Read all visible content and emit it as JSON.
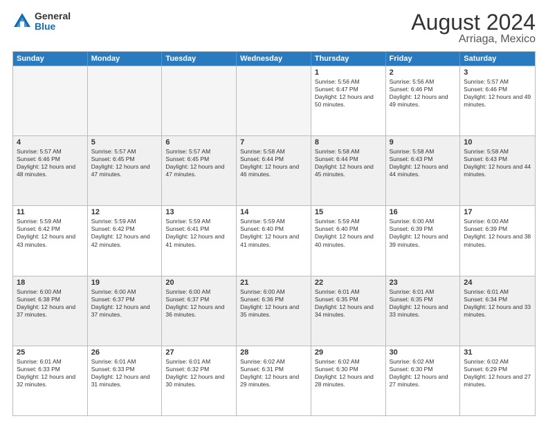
{
  "logo": {
    "general": "General",
    "blue": "Blue"
  },
  "title": "August 2024",
  "subtitle": "Arriaga, Mexico",
  "header_days": [
    "Sunday",
    "Monday",
    "Tuesday",
    "Wednesday",
    "Thursday",
    "Friday",
    "Saturday"
  ],
  "weeks": [
    [
      {
        "day": "",
        "empty": true
      },
      {
        "day": "",
        "empty": true
      },
      {
        "day": "",
        "empty": true
      },
      {
        "day": "",
        "empty": true
      },
      {
        "day": "1",
        "sunrise": "5:56 AM",
        "sunset": "6:47 PM",
        "daylight": "12 hours and 50 minutes."
      },
      {
        "day": "2",
        "sunrise": "5:56 AM",
        "sunset": "6:46 PM",
        "daylight": "12 hours and 49 minutes."
      },
      {
        "day": "3",
        "sunrise": "5:57 AM",
        "sunset": "6:46 PM",
        "daylight": "12 hours and 49 minutes."
      }
    ],
    [
      {
        "day": "4",
        "sunrise": "5:57 AM",
        "sunset": "6:46 PM",
        "daylight": "12 hours and 48 minutes."
      },
      {
        "day": "5",
        "sunrise": "5:57 AM",
        "sunset": "6:45 PM",
        "daylight": "12 hours and 47 minutes."
      },
      {
        "day": "6",
        "sunrise": "5:57 AM",
        "sunset": "6:45 PM",
        "daylight": "12 hours and 47 minutes."
      },
      {
        "day": "7",
        "sunrise": "5:58 AM",
        "sunset": "6:44 PM",
        "daylight": "12 hours and 46 minutes."
      },
      {
        "day": "8",
        "sunrise": "5:58 AM",
        "sunset": "6:44 PM",
        "daylight": "12 hours and 45 minutes."
      },
      {
        "day": "9",
        "sunrise": "5:58 AM",
        "sunset": "6:43 PM",
        "daylight": "12 hours and 44 minutes."
      },
      {
        "day": "10",
        "sunrise": "5:58 AM",
        "sunset": "6:43 PM",
        "daylight": "12 hours and 44 minutes."
      }
    ],
    [
      {
        "day": "11",
        "sunrise": "5:59 AM",
        "sunset": "6:42 PM",
        "daylight": "12 hours and 43 minutes."
      },
      {
        "day": "12",
        "sunrise": "5:59 AM",
        "sunset": "6:42 PM",
        "daylight": "12 hours and 42 minutes."
      },
      {
        "day": "13",
        "sunrise": "5:59 AM",
        "sunset": "6:41 PM",
        "daylight": "12 hours and 41 minutes."
      },
      {
        "day": "14",
        "sunrise": "5:59 AM",
        "sunset": "6:40 PM",
        "daylight": "12 hours and 41 minutes."
      },
      {
        "day": "15",
        "sunrise": "5:59 AM",
        "sunset": "6:40 PM",
        "daylight": "12 hours and 40 minutes."
      },
      {
        "day": "16",
        "sunrise": "6:00 AM",
        "sunset": "6:39 PM",
        "daylight": "12 hours and 39 minutes."
      },
      {
        "day": "17",
        "sunrise": "6:00 AM",
        "sunset": "6:39 PM",
        "daylight": "12 hours and 38 minutes."
      }
    ],
    [
      {
        "day": "18",
        "sunrise": "6:00 AM",
        "sunset": "6:38 PM",
        "daylight": "12 hours and 37 minutes."
      },
      {
        "day": "19",
        "sunrise": "6:00 AM",
        "sunset": "6:37 PM",
        "daylight": "12 hours and 37 minutes."
      },
      {
        "day": "20",
        "sunrise": "6:00 AM",
        "sunset": "6:37 PM",
        "daylight": "12 hours and 36 minutes."
      },
      {
        "day": "21",
        "sunrise": "6:00 AM",
        "sunset": "6:36 PM",
        "daylight": "12 hours and 35 minutes."
      },
      {
        "day": "22",
        "sunrise": "6:01 AM",
        "sunset": "6:35 PM",
        "daylight": "12 hours and 34 minutes."
      },
      {
        "day": "23",
        "sunrise": "6:01 AM",
        "sunset": "6:35 PM",
        "daylight": "12 hours and 33 minutes."
      },
      {
        "day": "24",
        "sunrise": "6:01 AM",
        "sunset": "6:34 PM",
        "daylight": "12 hours and 33 minutes."
      }
    ],
    [
      {
        "day": "25",
        "sunrise": "6:01 AM",
        "sunset": "6:33 PM",
        "daylight": "12 hours and 32 minutes."
      },
      {
        "day": "26",
        "sunrise": "6:01 AM",
        "sunset": "6:33 PM",
        "daylight": "12 hours and 31 minutes."
      },
      {
        "day": "27",
        "sunrise": "6:01 AM",
        "sunset": "6:32 PM",
        "daylight": "12 hours and 30 minutes."
      },
      {
        "day": "28",
        "sunrise": "6:02 AM",
        "sunset": "6:31 PM",
        "daylight": "12 hours and 29 minutes."
      },
      {
        "day": "29",
        "sunrise": "6:02 AM",
        "sunset": "6:30 PM",
        "daylight": "12 hours and 28 minutes."
      },
      {
        "day": "30",
        "sunrise": "6:02 AM",
        "sunset": "6:30 PM",
        "daylight": "12 hours and 27 minutes."
      },
      {
        "day": "31",
        "sunrise": "6:02 AM",
        "sunset": "6:29 PM",
        "daylight": "12 hours and 27 minutes."
      }
    ]
  ]
}
